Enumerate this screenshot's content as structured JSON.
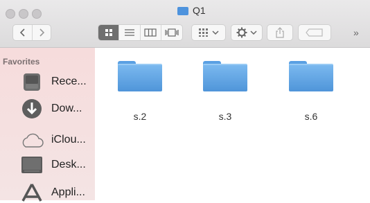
{
  "window": {
    "title": "Q1",
    "overflow_label": "»"
  },
  "toolbar": {
    "back_icon": "chevron-left-icon",
    "forward_icon": "chevron-right-icon",
    "view_icons": [
      "icon-view-icon",
      "list-view-icon",
      "column-view-icon",
      "cover-flow-icon"
    ],
    "arrange_icon": "arrange-grid-icon",
    "action_icon": "gear-icon",
    "share_icon": "share-icon",
    "tags_icon": "tag-icon"
  },
  "sidebar": {
    "section_label": "Favorites",
    "items": [
      {
        "label": "Rece...",
        "icon": "recents-icon"
      },
      {
        "label": "Dow...",
        "icon": "downloads-icon"
      },
      {
        "label": "iClou...",
        "icon": "icloud-icon"
      },
      {
        "label": "Desk...",
        "icon": "desktop-icon"
      },
      {
        "label": "Appli...",
        "icon": "applications-icon"
      }
    ]
  },
  "files": [
    {
      "name": "s.2",
      "icon": "folder-icon"
    },
    {
      "name": "s.3",
      "icon": "folder-icon"
    },
    {
      "name": "s.6",
      "icon": "folder-icon"
    }
  ],
  "colors": {
    "folder": "#5aa0e3",
    "sidebar": "#f6dcdc"
  }
}
